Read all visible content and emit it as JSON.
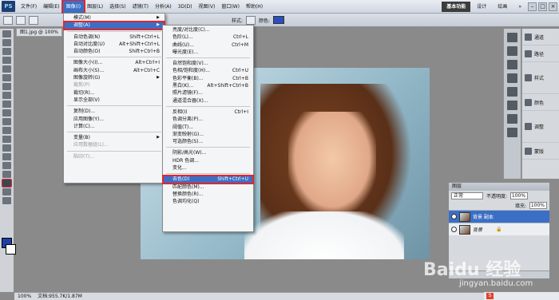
{
  "menubar": {
    "logo": "PS",
    "items": [
      "文件(F)",
      "编辑(E)",
      "图像(I)",
      "图层(L)",
      "选择(S)",
      "滤镜(T)",
      "分析(A)",
      "3D(D)",
      "视图(V)",
      "窗口(W)",
      "帮助(H)"
    ],
    "active": "图像(I)",
    "workspaces": [
      "基本功能",
      "设计",
      "绘画"
    ],
    "more": "»",
    "win_buttons": [
      "–",
      "□",
      "×"
    ]
  },
  "optbar": {
    "style_label": "样式:",
    "color_label": "颜色:",
    "accent": "#2a4fbe"
  },
  "doctab": "图1.jpg @ 100%",
  "image_menu": {
    "items": [
      "模式(M)",
      "调整(A)",
      "自动色调(N)",
      "自动对比度(U)",
      "自动颜色(O)",
      "图像大小(I)...",
      "画布大小(S)...",
      "图像旋转(G)",
      "裁剪(P)",
      "裁切(R)...",
      "显示全部(V)",
      "复制(D)...",
      "应用图像(Y)...",
      "计算(C)...",
      "变量(B)",
      "应用数据组(L)...",
      "陷印(T)..."
    ],
    "shortcuts": [
      "",
      "",
      "Shift+Ctrl+L",
      "Alt+Shift+Ctrl+L",
      "Shift+Ctrl+B",
      "Alt+Ctrl+I",
      "Alt+Ctrl+C",
      "",
      "",
      "",
      "",
      "",
      "",
      "",
      "",
      "",
      ""
    ]
  },
  "adjust_menu": {
    "items": [
      "亮度/对比度(C)...",
      "色阶(L)...",
      "曲线(U)...",
      "曝光度(E)...",
      "自然饱和度(V)...",
      "色相/饱和度(H)...",
      "色彩平衡(B)...",
      "黑白(K)...",
      "照片滤镜(F)...",
      "通道混合器(X)...",
      "反相(I)",
      "色调分离(P)...",
      "阈值(T)...",
      "渐变映射(G)...",
      "可选颜色(S)...",
      "阴影/高光(W)...",
      "HDR 色调...",
      "变化...",
      "去色(D)",
      "匹配颜色(M)...",
      "替换颜色(R)...",
      "色调均化(Q)"
    ],
    "shortcuts": [
      "",
      "Ctrl+L",
      "Ctrl+M",
      "",
      "",
      "Ctrl+U",
      "Ctrl+B",
      "Alt+Shift+Ctrl+B",
      "",
      "",
      "Ctrl+I",
      "",
      "",
      "",
      "",
      "",
      "",
      "",
      "Shift+Ctrl+U",
      "",
      "",
      ""
    ]
  },
  "panels": [
    "通道",
    "路径",
    "样式",
    "颜色",
    "调整",
    "蒙版"
  ],
  "layers": {
    "title": "图层",
    "blend": "正常",
    "opacity_label": "不透明度:",
    "opacity": "100%",
    "fill_label": "填充:",
    "fill": "100%",
    "layer1": "背景 副本",
    "layer2": "背景"
  },
  "status": {
    "zoom": "100%",
    "doc": "文档:955.7K/1.87M"
  },
  "watermark": "Baidu 经验",
  "watermark_url": "jingyan.baidu.com",
  "tray_icon": "S"
}
